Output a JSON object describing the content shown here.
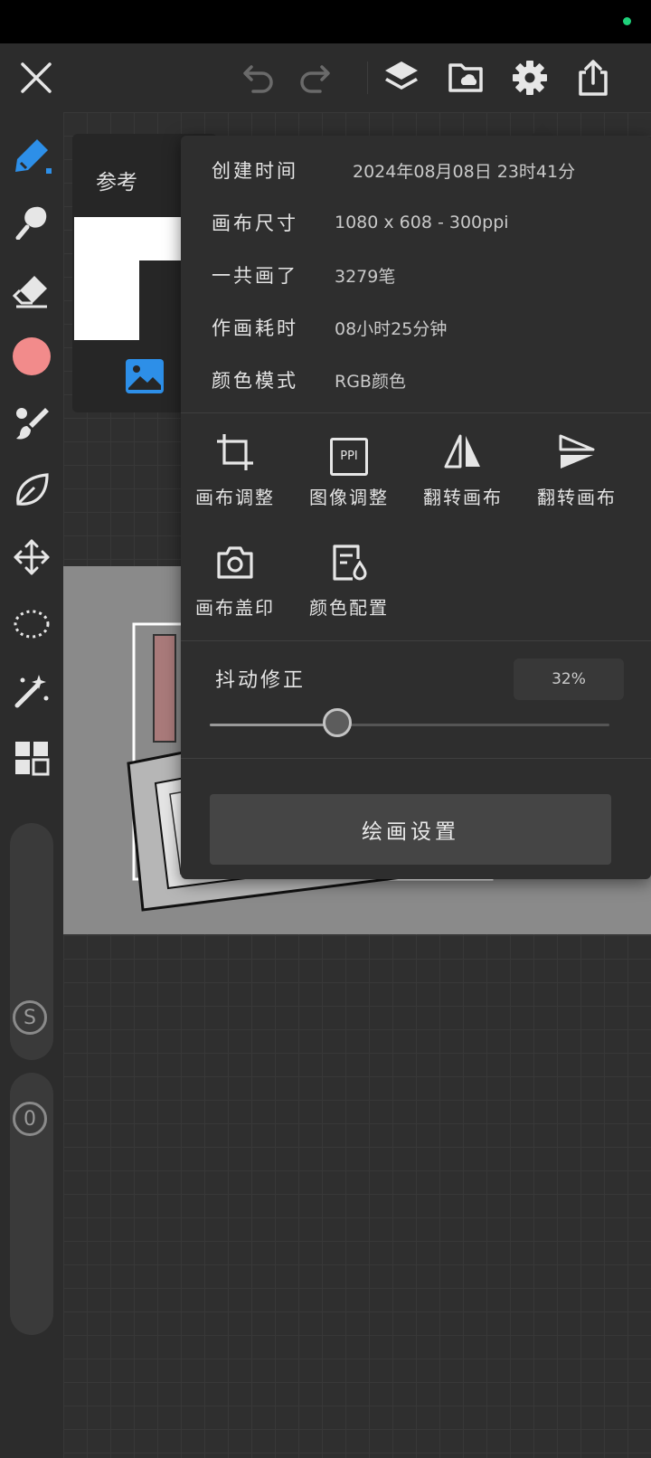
{
  "toolbar": {
    "icons": [
      "close-icon",
      "undo-icon",
      "redo-icon",
      "layers-icon",
      "cloud-folder-icon",
      "gear-icon",
      "share-icon"
    ]
  },
  "sidebar": {
    "tools": [
      "brush-icon",
      "smudge-icon",
      "eraser-icon",
      "color-swatch",
      "paint-brushes-icon",
      "leaf-icon",
      "move-icon",
      "lasso-icon",
      "magic-wand-icon",
      "grid-icon"
    ],
    "active_color": "#f28b8b",
    "accent_color": "#2d8fe8",
    "size_marker": "S",
    "opacity_marker": "0"
  },
  "reference": {
    "title": "参考"
  },
  "info": {
    "rows": [
      {
        "key": "创建时间",
        "value": "2024年08月08日 23时41分"
      },
      {
        "key": "画布尺寸",
        "value": "1080 x 608 - 300ppi"
      },
      {
        "key": "一共画了",
        "value": "3279笔"
      },
      {
        "key": "作画耗时",
        "value": "08小时25分钟"
      },
      {
        "key": "颜色模式",
        "value": "RGB颜色"
      }
    ]
  },
  "actions": [
    {
      "label": "画布调整",
      "icon": "crop-icon"
    },
    {
      "label": "图像调整",
      "icon": "ppi-icon",
      "icon_text": "PPI"
    },
    {
      "label": "翻转画布",
      "icon": "flip-horizontal-icon"
    },
    {
      "label": "翻转画布",
      "icon": "flip-vertical-icon"
    },
    {
      "label": "画布盖印",
      "icon": "camera-icon"
    },
    {
      "label": "颜色配置",
      "icon": "color-profile-icon"
    }
  ],
  "stabilizer": {
    "label": "抖动修正",
    "value_text": "32%",
    "value": 0.32
  },
  "settings_button": "绘画设置"
}
